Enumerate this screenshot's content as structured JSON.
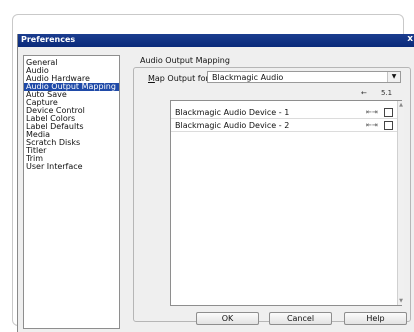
{
  "window": {
    "title": "Preferences",
    "close_label": "x"
  },
  "sidebar": {
    "items": [
      {
        "label": "General",
        "selected": false
      },
      {
        "label": "Audio",
        "selected": false
      },
      {
        "label": "Audio Hardware",
        "selected": false
      },
      {
        "label": "Audio Output Mapping",
        "selected": true
      },
      {
        "label": "Auto Save",
        "selected": false
      },
      {
        "label": "Capture",
        "selected": false
      },
      {
        "label": "Device Control",
        "selected": false
      },
      {
        "label": "Label Colors",
        "selected": false
      },
      {
        "label": "Label Defaults",
        "selected": false
      },
      {
        "label": "Media",
        "selected": false
      },
      {
        "label": "Scratch Disks",
        "selected": false
      },
      {
        "label": "Titler",
        "selected": false
      },
      {
        "label": "Trim",
        "selected": false
      },
      {
        "label": "User Interface",
        "selected": false
      }
    ]
  },
  "main": {
    "section_title": "Audio Output Mapping",
    "map_output": {
      "label_first_letter": "M",
      "label_rest": "ap Output for:",
      "value": "Blackmagic Audio"
    },
    "channel_headers": {
      "route_label": "←",
      "count_label": "5.1"
    },
    "devices": [
      {
        "label": "Blackmagic Audio Device - 1",
        "route_icon": "⇤⇥"
      },
      {
        "label": "Blackmagic Audio Device - 2",
        "route_icon": "⇤⇥"
      }
    ]
  },
  "buttons": {
    "ok": "OK",
    "cancel": "Cancel",
    "help": "Help"
  },
  "colors": {
    "title_bar": "#0a2a7a",
    "selection": "#1f4aa8",
    "dialog_bg": "#efefef"
  }
}
